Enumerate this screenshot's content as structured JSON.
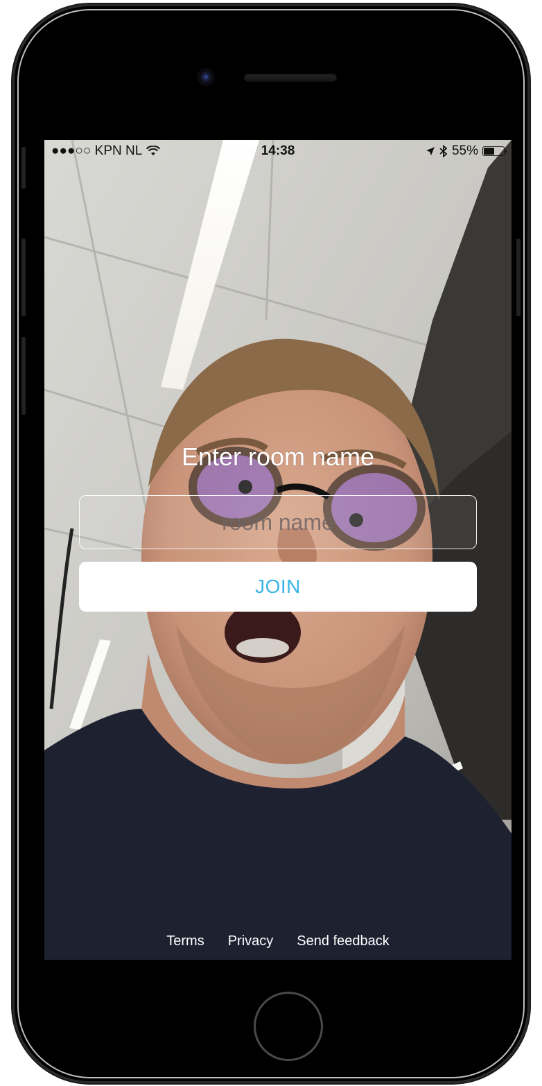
{
  "status_bar": {
    "carrier": "●●●○○ KPN NL",
    "time": "14:38",
    "battery": "55%",
    "battery_level": 0.55,
    "icons": [
      "wifi-icon",
      "location-arrow-icon",
      "bluetooth-icon",
      "battery-icon"
    ]
  },
  "main": {
    "title": "Enter room name",
    "room_input": {
      "placeholder": "room name",
      "value": ""
    },
    "join_label": "JOIN"
  },
  "footer": {
    "terms": "Terms",
    "privacy": "Privacy",
    "feedback": "Send feedback"
  },
  "colors": {
    "accent": "#3ab4e6",
    "title_text": "#ffffff",
    "button_bg": "#ffffff"
  }
}
